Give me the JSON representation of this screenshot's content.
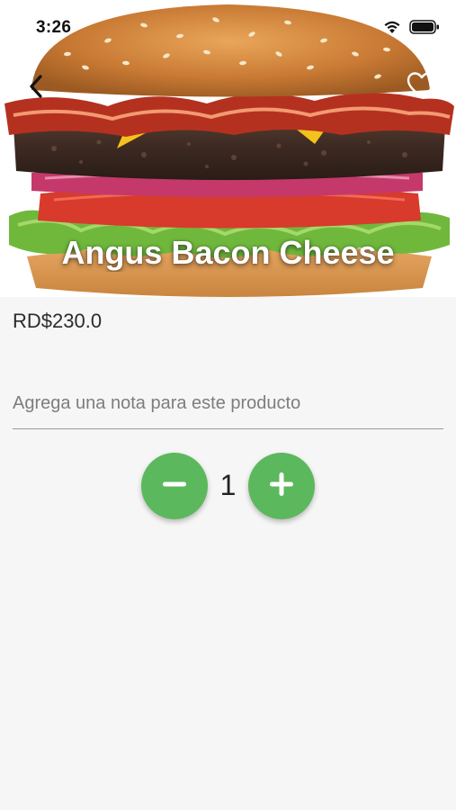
{
  "status_bar": {
    "time": "3:26",
    "icons": [
      "wifi-icon",
      "battery-icon"
    ]
  },
  "header": {
    "back_icon": "chevron-left-icon",
    "favorite_icon": "heart-outline-icon"
  },
  "product": {
    "title": "Angus Bacon Cheese",
    "price": "RD$230.0",
    "image": "burger-photo"
  },
  "note": {
    "value": "",
    "placeholder": "Agrega una nota para este producto"
  },
  "quantity": {
    "value": "1",
    "decrement_icon": "minus-icon",
    "increment_icon": "plus-icon"
  },
  "colors": {
    "accent": "#5cb85c",
    "background": "#f6f6f6",
    "price_text": "#2b2b2b"
  }
}
